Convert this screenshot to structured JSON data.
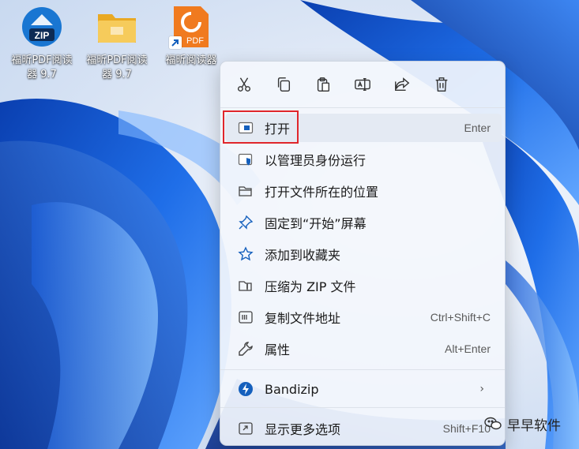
{
  "desktop": {
    "icons": [
      {
        "label": "福昕PDF阅读器 9.7",
        "icon": "zip-app-icon",
        "color": "#1976d2"
      },
      {
        "label": "福昕PDF阅读器 9.7",
        "icon": "folder-icon",
        "color": "#f2c14e"
      },
      {
        "label": "福昕阅读器",
        "icon": "foxit-pdf-icon",
        "color": "#f07a1f"
      }
    ]
  },
  "context_menu": {
    "toolbar": [
      {
        "name": "cut",
        "icon": "scissors-icon"
      },
      {
        "name": "copy",
        "icon": "copy-icon"
      },
      {
        "name": "paste",
        "icon": "clipboard-icon"
      },
      {
        "name": "rename",
        "icon": "rename-icon"
      },
      {
        "name": "share",
        "icon": "share-icon"
      },
      {
        "name": "delete",
        "icon": "trash-icon"
      }
    ],
    "items": [
      {
        "label": "打开",
        "shortcut": "Enter",
        "icon": "open-window-icon"
      },
      {
        "label": "以管理员身份运行",
        "shortcut": "",
        "icon": "shield-window-icon"
      },
      {
        "label": "打开文件所在的位置",
        "shortcut": "",
        "icon": "folder-open-icon"
      },
      {
        "label": "固定到“开始”屏幕",
        "shortcut": "",
        "icon": "pin-icon"
      },
      {
        "label": "添加到收藏夹",
        "shortcut": "",
        "icon": "star-icon"
      },
      {
        "label": "压缩为 ZIP 文件",
        "shortcut": "",
        "icon": "zip-folder-icon"
      },
      {
        "label": "复制文件地址",
        "shortcut": "Ctrl+Shift+C",
        "icon": "copy-path-icon"
      },
      {
        "label": "属性",
        "shortcut": "Alt+Enter",
        "icon": "wrench-icon"
      }
    ],
    "bandizip": {
      "label": "Bandizip",
      "icon": "bandizip-icon",
      "chevron": "›"
    },
    "more": {
      "label": "显示更多选项",
      "shortcut": "Shift+F10",
      "icon": "more-options-icon"
    }
  },
  "highlight_color": "#e0262b",
  "accent": "#1560bd",
  "watermark": {
    "text": "早早软件",
    "icon": "wechat-icon"
  }
}
